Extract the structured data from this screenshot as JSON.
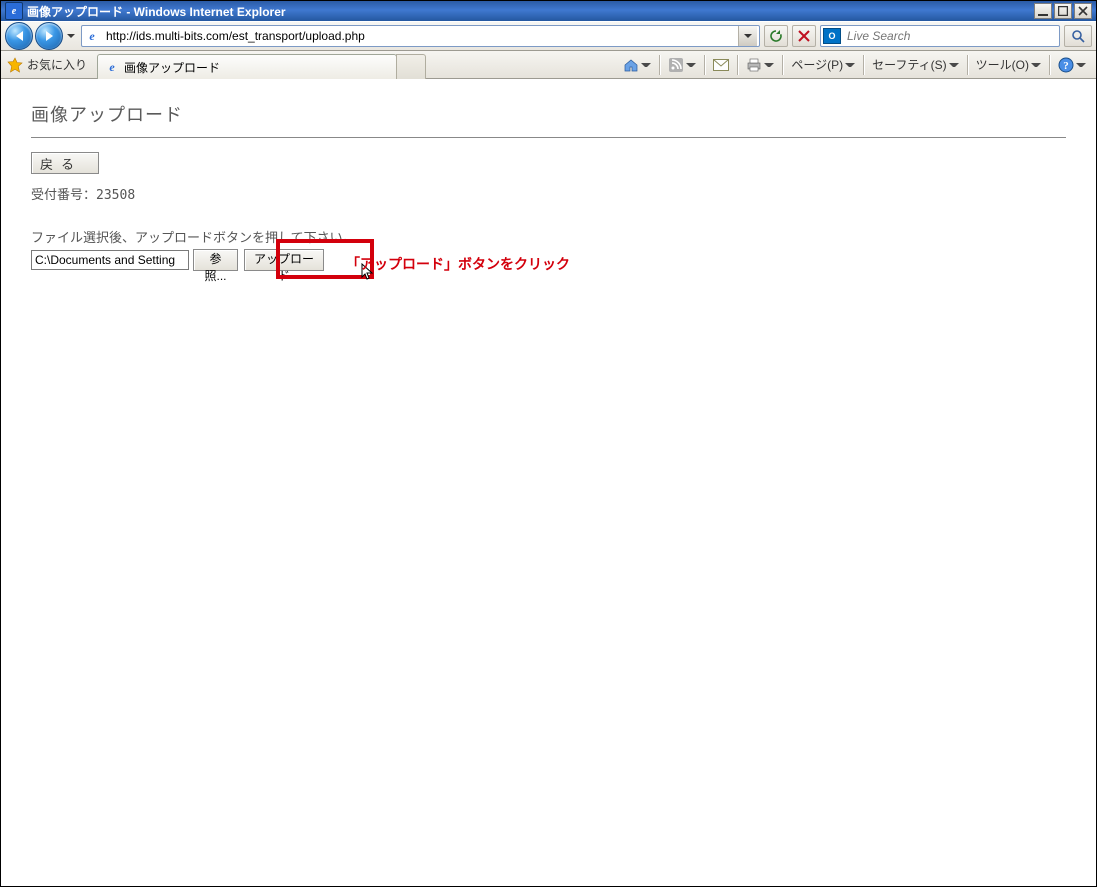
{
  "titlebar": {
    "text": "画像アップロード - Windows Internet Explorer"
  },
  "addressbar": {
    "url": "http://ids.multi-bits.com/est_transport/upload.php"
  },
  "search": {
    "placeholder": "Live Search",
    "provider_label": "O"
  },
  "toolbar2": {
    "favorites_label": "お気に入り",
    "tab_label": "画像アップロード",
    "page_menu": "ページ(P)",
    "safety_menu": "セーフティ(S)",
    "tools_menu": "ツール(O)"
  },
  "page": {
    "title": "画像アップロード",
    "back_button": "戻る",
    "receipt_label": "受付番号：",
    "receipt_number": "23508",
    "instruction": "ファイル選択後、アップロードボタンを押して下さい。",
    "file_value": "C:\\Documents and Setting",
    "browse_button": "参照...",
    "upload_button": "アップロード",
    "annotation": "「アップロード」ボタンをクリック"
  }
}
